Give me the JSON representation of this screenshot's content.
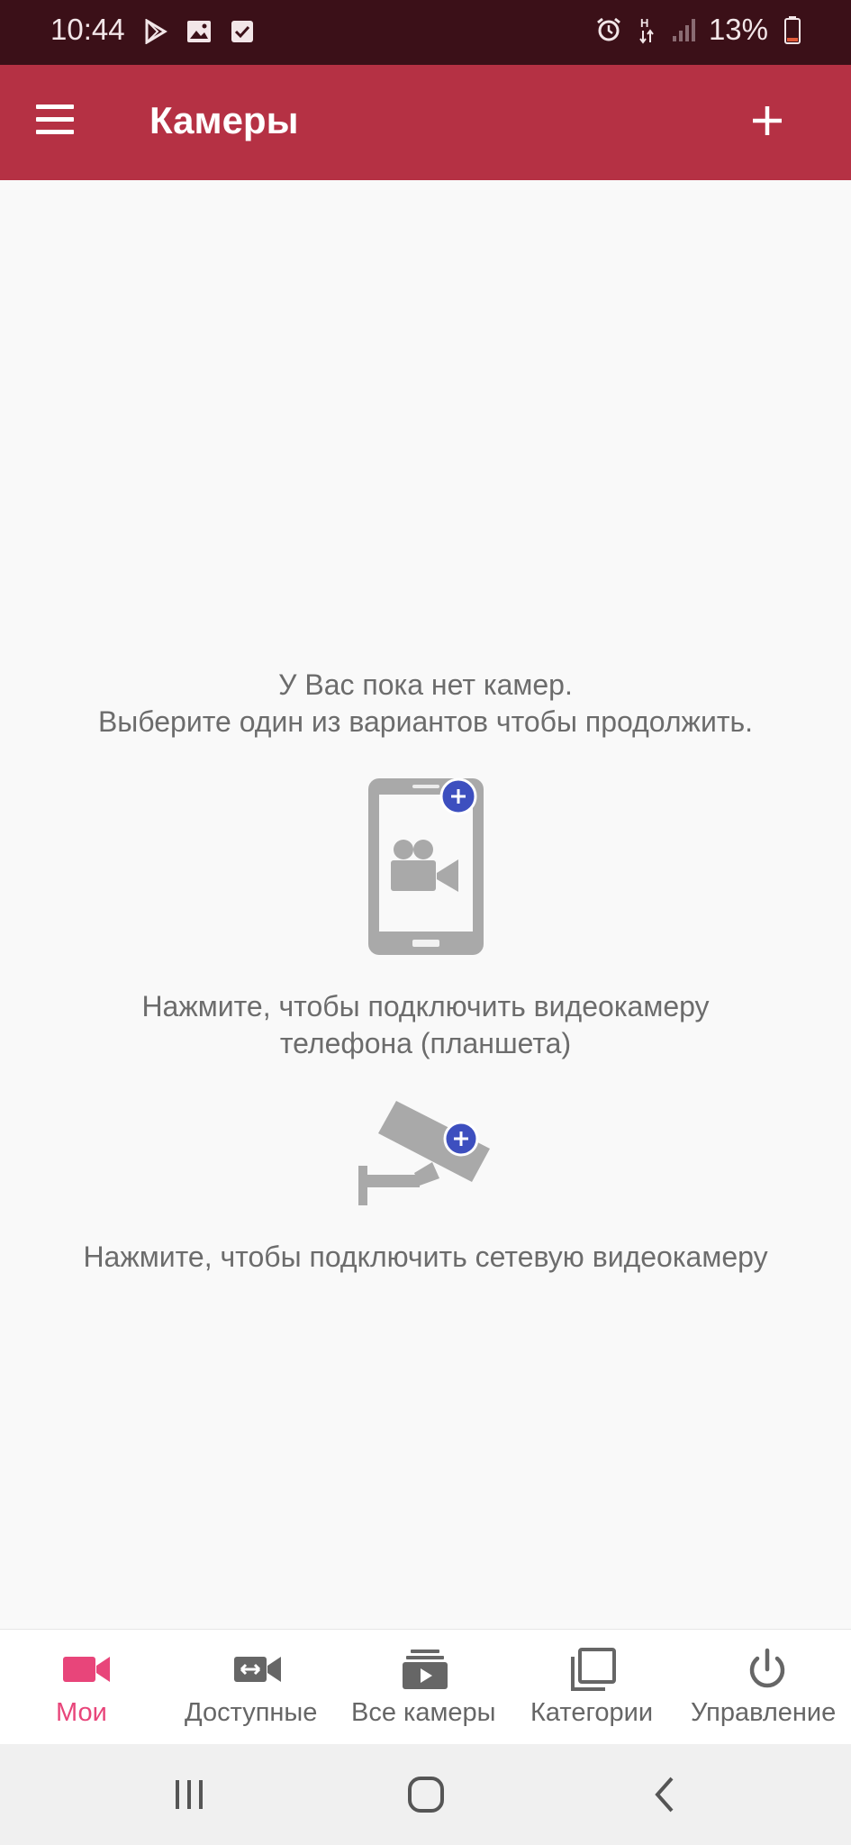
{
  "status_bar": {
    "time": "10:44",
    "left_icons": [
      "play-store-icon",
      "image-icon",
      "checkbox-icon"
    ],
    "right_icons": [
      "alarm-icon",
      "network-h-icon",
      "signal-icon",
      "battery-icon"
    ],
    "battery_percent": "13%"
  },
  "app_bar": {
    "title": "Камеры",
    "menu_icon": "hamburger-menu-icon",
    "add_icon": "plus-icon"
  },
  "main": {
    "empty_line1": "У Вас пока нет камер.",
    "empty_line2": "Выберите один из вариантов чтобы продолжить.",
    "phone_option_line1": "Нажмите, чтобы подключить видеокамеру",
    "phone_option_line2": "телефона (планшета)",
    "netcam_option_label": "Нажмите, чтобы подключить сетевую видеокамеру"
  },
  "bottom_nav": {
    "items": [
      {
        "label": "Мои",
        "icon": "video-camera-icon",
        "active": true
      },
      {
        "label": "Доступные",
        "icon": "shared-camera-icon",
        "active": false
      },
      {
        "label": "Все камеры",
        "icon": "video-library-icon",
        "active": false
      },
      {
        "label": "Категории",
        "icon": "categories-icon",
        "active": false
      },
      {
        "label": "Управление",
        "icon": "power-icon",
        "active": false
      }
    ]
  },
  "colors": {
    "status_bar": "#3b1018",
    "app_bar": "#b53144",
    "active_nav": "#e8457a",
    "inactive_nav": "#666666",
    "plus_badge": "#3d4fbf",
    "illustration_gray": "#a9a9a9"
  }
}
